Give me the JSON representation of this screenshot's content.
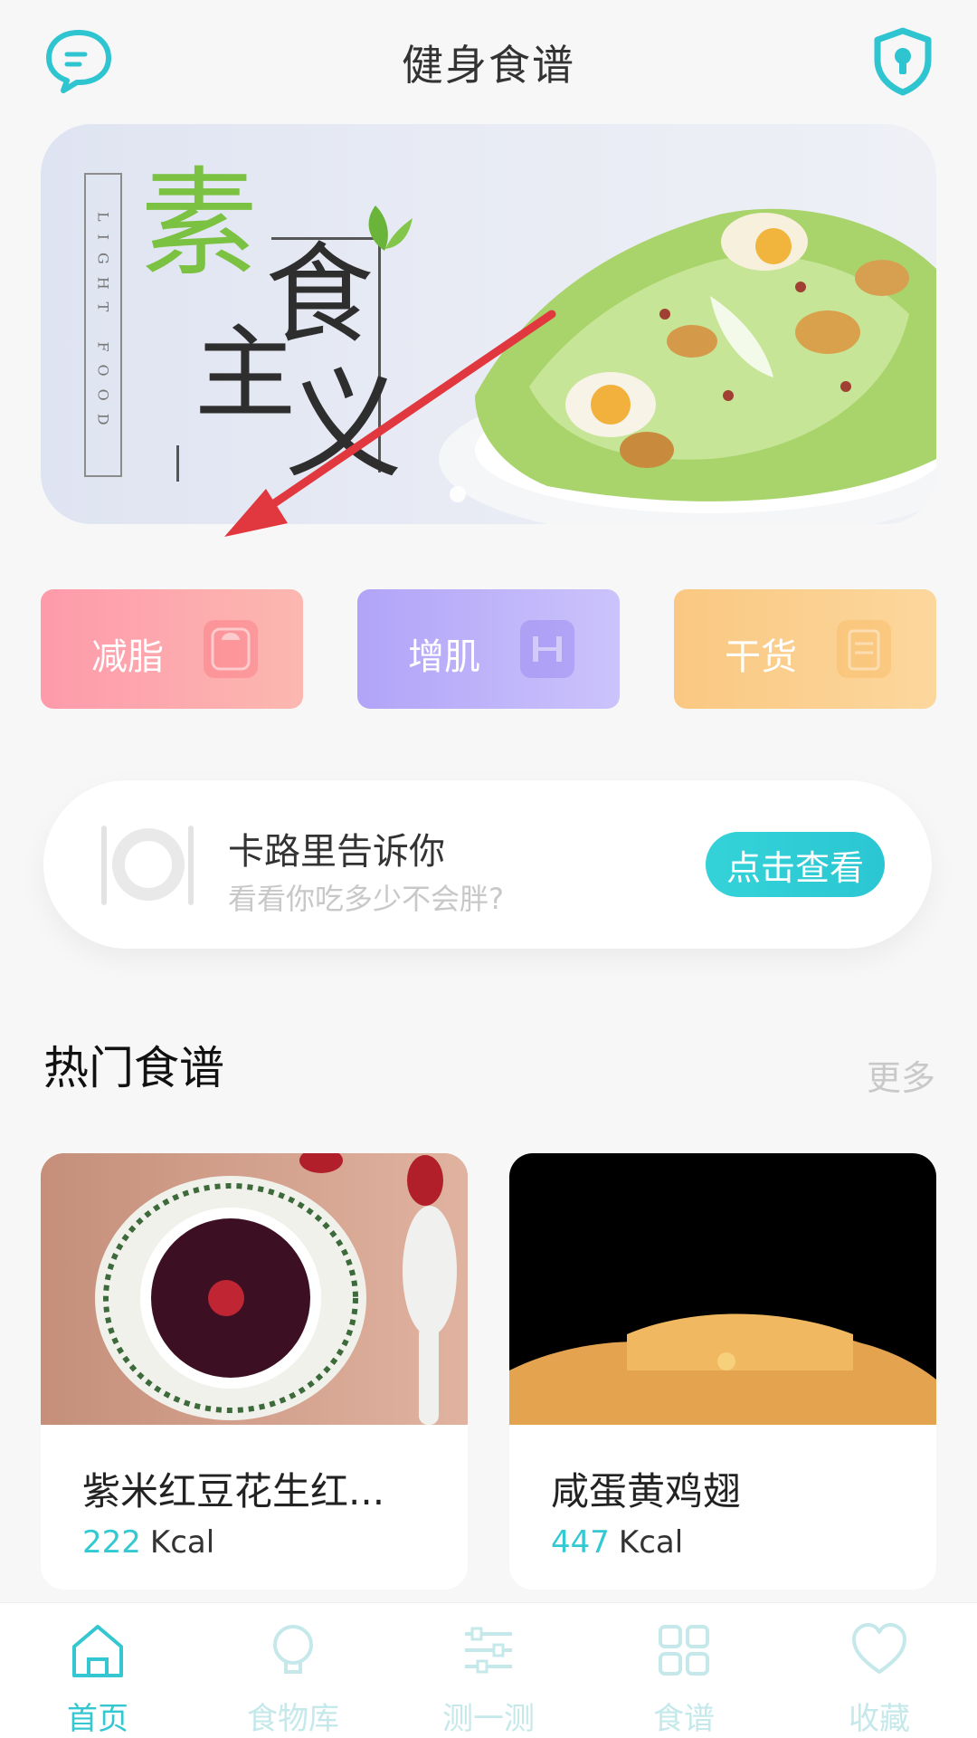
{
  "header": {
    "title": "健身食谱",
    "left_icon": "chat-bubble-icon",
    "right_icon": "shield-lock-icon"
  },
  "banner": {
    "vertical_text": "LIGHT FOOD",
    "char1": "素",
    "char2": "主",
    "char3": "食",
    "char4": "义"
  },
  "categories": [
    {
      "label": "减脂",
      "icon": "scale-icon"
    },
    {
      "label": "增肌",
      "icon": "barbell-icon"
    },
    {
      "label": "干货",
      "icon": "clipboard-icon"
    }
  ],
  "calorie_card": {
    "title": "卡路里告诉你",
    "subtitle": "看看你吃多少不会胖?",
    "button": "点击查看",
    "icon": "plate-cutlery-icon"
  },
  "section": {
    "title": "热门食谱",
    "more": "更多"
  },
  "recipes": [
    {
      "name": "紫米红豆花生红...",
      "kcal": "222",
      "unit": "Kcal"
    },
    {
      "name": "咸蛋黄鸡翅",
      "kcal": "447",
      "unit": "Kcal"
    }
  ],
  "tabs": [
    {
      "label": "首页",
      "icon": "home-icon",
      "active": true
    },
    {
      "label": "食物库",
      "icon": "bulb-icon",
      "active": false
    },
    {
      "label": "测一测",
      "icon": "sliders-icon",
      "active": false
    },
    {
      "label": "食谱",
      "icon": "grid-icon",
      "active": false
    },
    {
      "label": "收藏",
      "icon": "heart-icon",
      "active": false
    }
  ],
  "colors": {
    "accent": "#34c7d1",
    "red_arrow": "#e0383e"
  }
}
